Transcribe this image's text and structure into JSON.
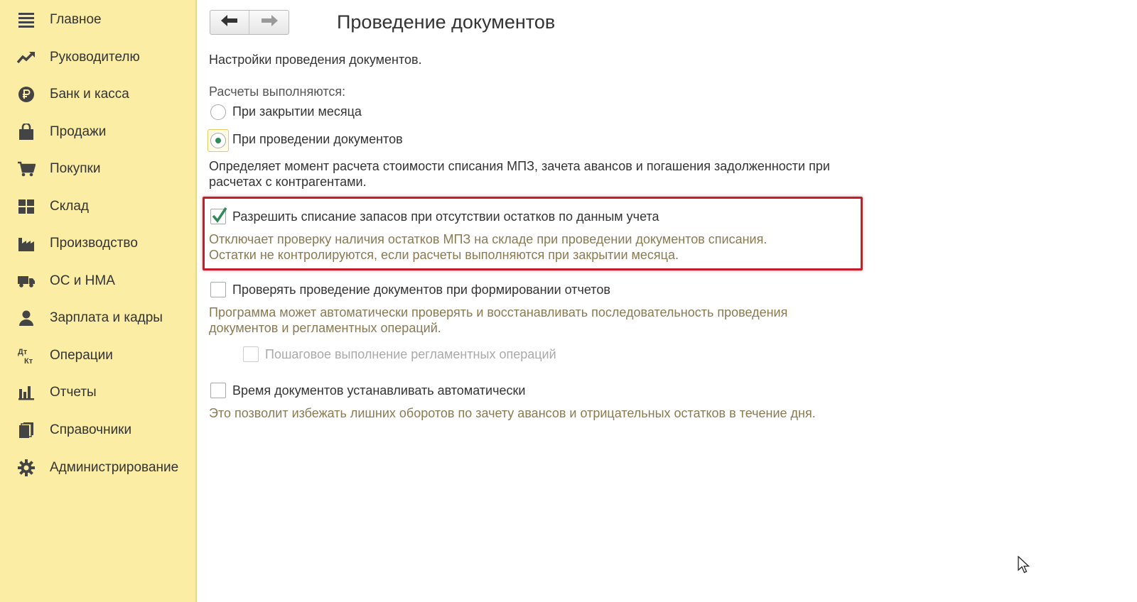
{
  "sidebar": {
    "items": [
      {
        "label": "Главное",
        "icon": "menu-icon"
      },
      {
        "label": "Руководителю",
        "icon": "trend-icon"
      },
      {
        "label": "Банк и касса",
        "icon": "ruble-icon"
      },
      {
        "label": "Продажи",
        "icon": "shopping-bag-icon"
      },
      {
        "label": "Покупки",
        "icon": "cart-icon"
      },
      {
        "label": "Склад",
        "icon": "warehouse-icon"
      },
      {
        "label": "Производство",
        "icon": "factory-icon"
      },
      {
        "label": "ОС и НМА",
        "icon": "truck-icon"
      },
      {
        "label": "Зарплата и кадры",
        "icon": "person-icon"
      },
      {
        "label": "Операции",
        "icon": "dt-kt-icon"
      },
      {
        "label": "Отчеты",
        "icon": "bar-chart-icon"
      },
      {
        "label": "Справочники",
        "icon": "books-icon"
      },
      {
        "label": "Администрирование",
        "icon": "gear-icon"
      }
    ]
  },
  "header": {
    "title": "Проведение документов",
    "back_icon": "arrow-left-icon",
    "forward_icon": "arrow-right-icon"
  },
  "form": {
    "subtitle": "Настройки проведения документов.",
    "calc_group_label": "Расчеты выполняются:",
    "radio_options": [
      {
        "label": "При закрытии месяца",
        "selected": false
      },
      {
        "label": "При проведении документов",
        "selected": true
      }
    ],
    "calc_description": [
      "Определяет момент расчета стоимости списания МПЗ, зачета авансов и погашения задолженности при",
      "расчетах с контрагентами."
    ],
    "allow_writeoff": {
      "label": "Разрешить списание запасов при отсутствии остатков по данным учета",
      "checked": true,
      "hint": [
        "Отключает проверку наличия остатков МПЗ на складе при проведении документов списания.",
        "Остатки не контролируются, если расчеты выполняются при закрытии месяца."
      ]
    },
    "check_posting": {
      "label": "Проверять проведение документов при формировании отчетов",
      "checked": false,
      "hint": [
        "Программа может автоматически проверять и восстанавливать последовательность проведения",
        "документов и регламентных операций."
      ]
    },
    "step_by_step": {
      "label": "Пошаговое выполнение регламентных операций",
      "checked": false,
      "enabled": false
    },
    "auto_time": {
      "label": "Время документов устанавливать автоматически",
      "checked": false,
      "hint": "Это позволит избежать лишних оборотов по зачету авансов и отрицательных остатков в течение дня."
    }
  },
  "colors": {
    "sidebar_bg": "#fbeda4",
    "hint_text": "#8a7a52",
    "check_green": "#2e8b57",
    "highlight_red": "#c41e2a"
  }
}
